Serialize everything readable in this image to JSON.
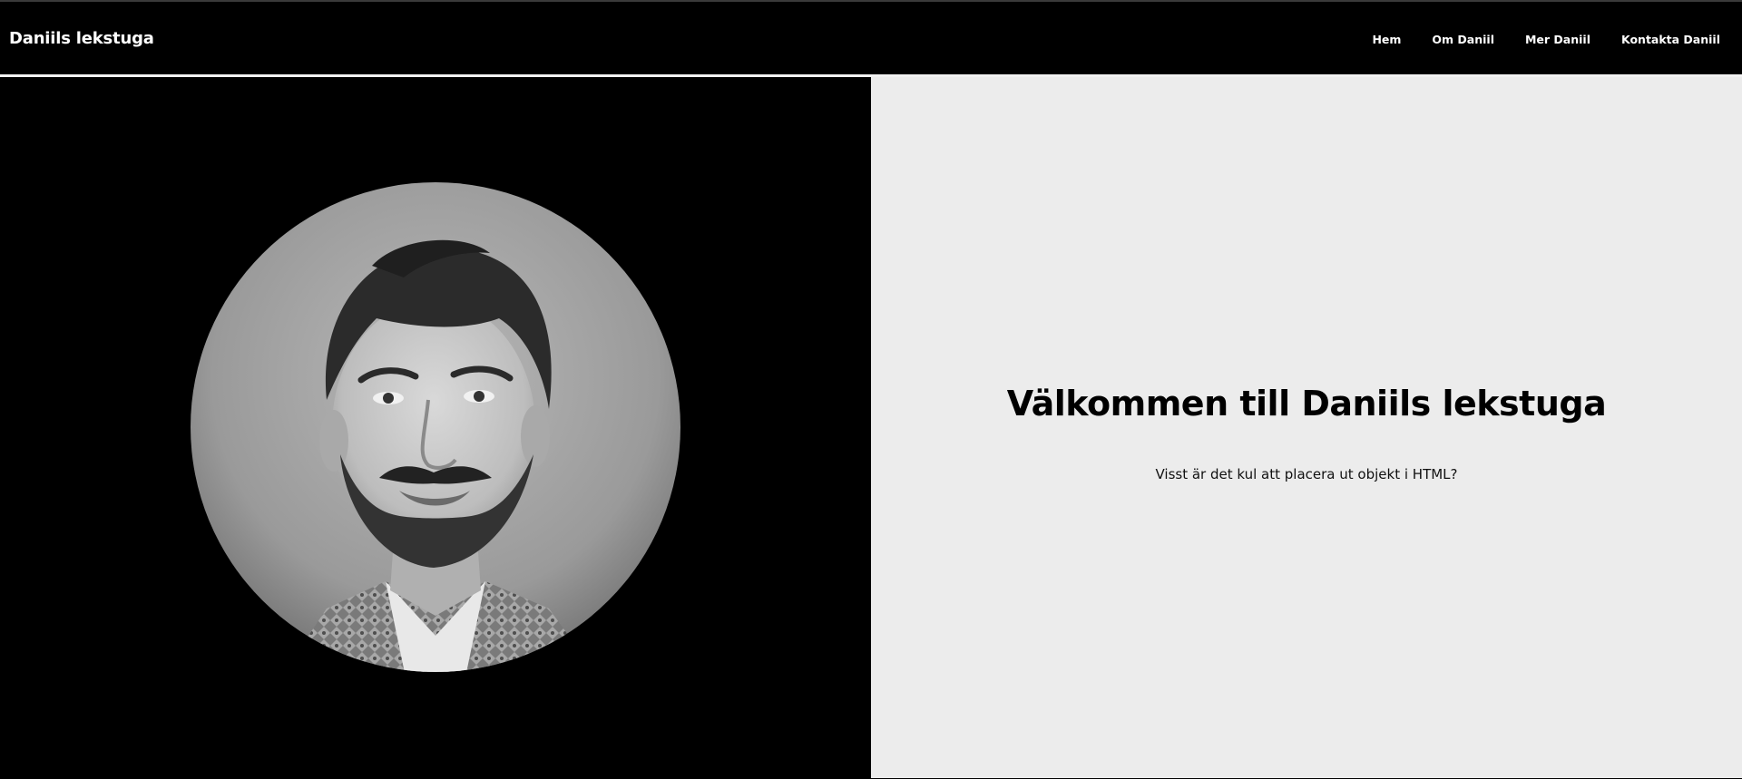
{
  "nav": {
    "brand": "Daniils lekstuga",
    "links": [
      "Hem",
      "Om Daniil",
      "Mer Daniil",
      "Kontakta Daniil"
    ]
  },
  "hero": {
    "title": "Välkommen till Daniils lekstuga",
    "subtitle": "Visst är det kul att placera ut objekt i HTML?",
    "photo_icon": "portrait-photo"
  },
  "colors": {
    "nav_background": "#000000",
    "left_panel": "#000000",
    "right_panel": "#ececec",
    "nav_text": "#ffffff"
  }
}
